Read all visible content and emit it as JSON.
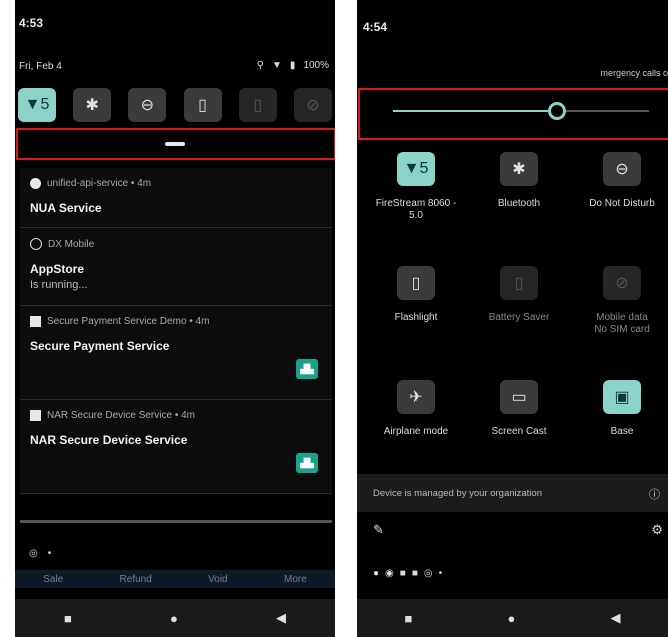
{
  "left_screen": {
    "time": "4:53",
    "date": "Fri, Feb 4",
    "battery": "100%",
    "quick_tiles": [
      {
        "icon": "wifi-icon",
        "glyph": "▼5",
        "state": "active"
      },
      {
        "icon": "bluetooth-icon",
        "glyph": "✱",
        "state": "off"
      },
      {
        "icon": "do-not-disturb-icon",
        "glyph": "⊖",
        "state": "off"
      },
      {
        "icon": "flashlight-icon",
        "glyph": "▯",
        "state": "off"
      },
      {
        "icon": "battery-saver-icon",
        "glyph": "▯",
        "state": "dim"
      },
      {
        "icon": "mobile-data-icon",
        "glyph": "⊘",
        "state": "dim"
      }
    ],
    "notifications": [
      {
        "app": "unified-api-service • 4m",
        "title": "NUA Service",
        "subtitle": "",
        "badge": "circle"
      },
      {
        "app": "DX Mobile",
        "title": "AppStore",
        "subtitle": "Is running...",
        "badge": "ring"
      },
      {
        "app": "Secure Payment Service Demo • 4m",
        "title": "Secure Payment Service",
        "subtitle": "",
        "badge": "square"
      },
      {
        "app": "NAR Secure Device Service • 4m",
        "title": "NAR Secure Device Service",
        "subtitle": "",
        "badge": "square"
      }
    ],
    "actions": [
      "Sale",
      "Refund",
      "Void",
      "More"
    ]
  },
  "right_screen": {
    "time": "4:54",
    "emergency": "mergency calls o",
    "brightness_level": 0.64,
    "tiles": [
      {
        "label": "FireStream 8060 - 5.0",
        "icon": "wifi-icon",
        "glyph": "▼5",
        "state": "active"
      },
      {
        "label": "Bluetooth",
        "icon": "bluetooth-icon",
        "glyph": "✱",
        "state": "off"
      },
      {
        "label": "Do Not Disturb",
        "icon": "do-not-disturb-icon",
        "glyph": "⊖",
        "state": "off"
      },
      {
        "label": "Flashlight",
        "icon": "flashlight-icon",
        "glyph": "▯",
        "state": "off"
      },
      {
        "label": "Battery Saver",
        "icon": "battery-saver-icon",
        "glyph": "▯",
        "state": "dim"
      },
      {
        "label": "Mobile data\nNo SIM card",
        "icon": "mobile-data-icon",
        "glyph": "⊘",
        "state": "dim"
      },
      {
        "label": "Airplane mode",
        "icon": "airplane-icon",
        "glyph": "✈",
        "state": "off"
      },
      {
        "label": "Screen Cast",
        "icon": "cast-icon",
        "glyph": "▭",
        "state": "off"
      },
      {
        "label": "Base",
        "icon": "base-icon",
        "glyph": "▣",
        "state": "active"
      }
    ],
    "managed_text": "Device is managed by your organization"
  },
  "nav": {
    "recents": "■",
    "home": "●",
    "back": "◀"
  }
}
